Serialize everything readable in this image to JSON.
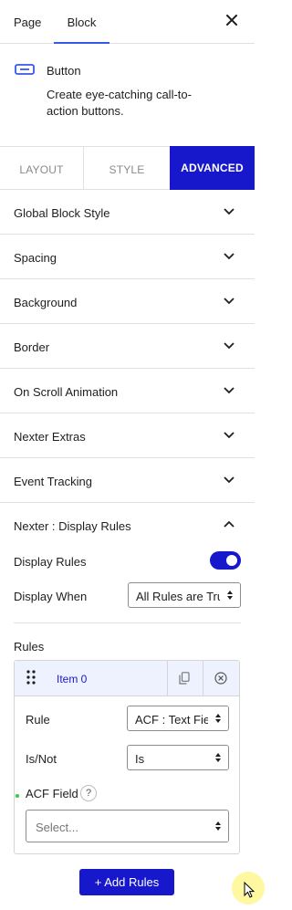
{
  "topbar": {
    "tabs": [
      "Page",
      "Block"
    ],
    "active_tab": "Block"
  },
  "block": {
    "name": "Button",
    "description": "Create eye-catching call-to-action buttons.",
    "icon": "button-icon"
  },
  "mode_tabs": {
    "layout": "LAYOUT",
    "style": "STYLE",
    "advanced": "ADVANCED",
    "active": "ADVANCED"
  },
  "panels": [
    "Global Block Style",
    "Spacing",
    "Background",
    "Border",
    "On Scroll Animation",
    "Nexter Extras",
    "Event Tracking"
  ],
  "display_rules": {
    "title": "Nexter : Display Rules",
    "toggle_label": "Display Rules",
    "toggle_on": true,
    "when_label": "Display When",
    "when_value": "All Rules are True",
    "rules_label": "Rules",
    "item": {
      "name": "Item 0",
      "rule_label": "Rule",
      "rule_value": "ACF : Text Field",
      "isnot_label": "Is/Not",
      "isnot_value": "Is",
      "acf_label": "ACF Field",
      "acf_help": "?",
      "acf_placeholder": "Select..."
    },
    "add_button": "+ Add Rules"
  },
  "colors": {
    "accent": "#1717cc",
    "tab_underline": "#3858e9"
  }
}
